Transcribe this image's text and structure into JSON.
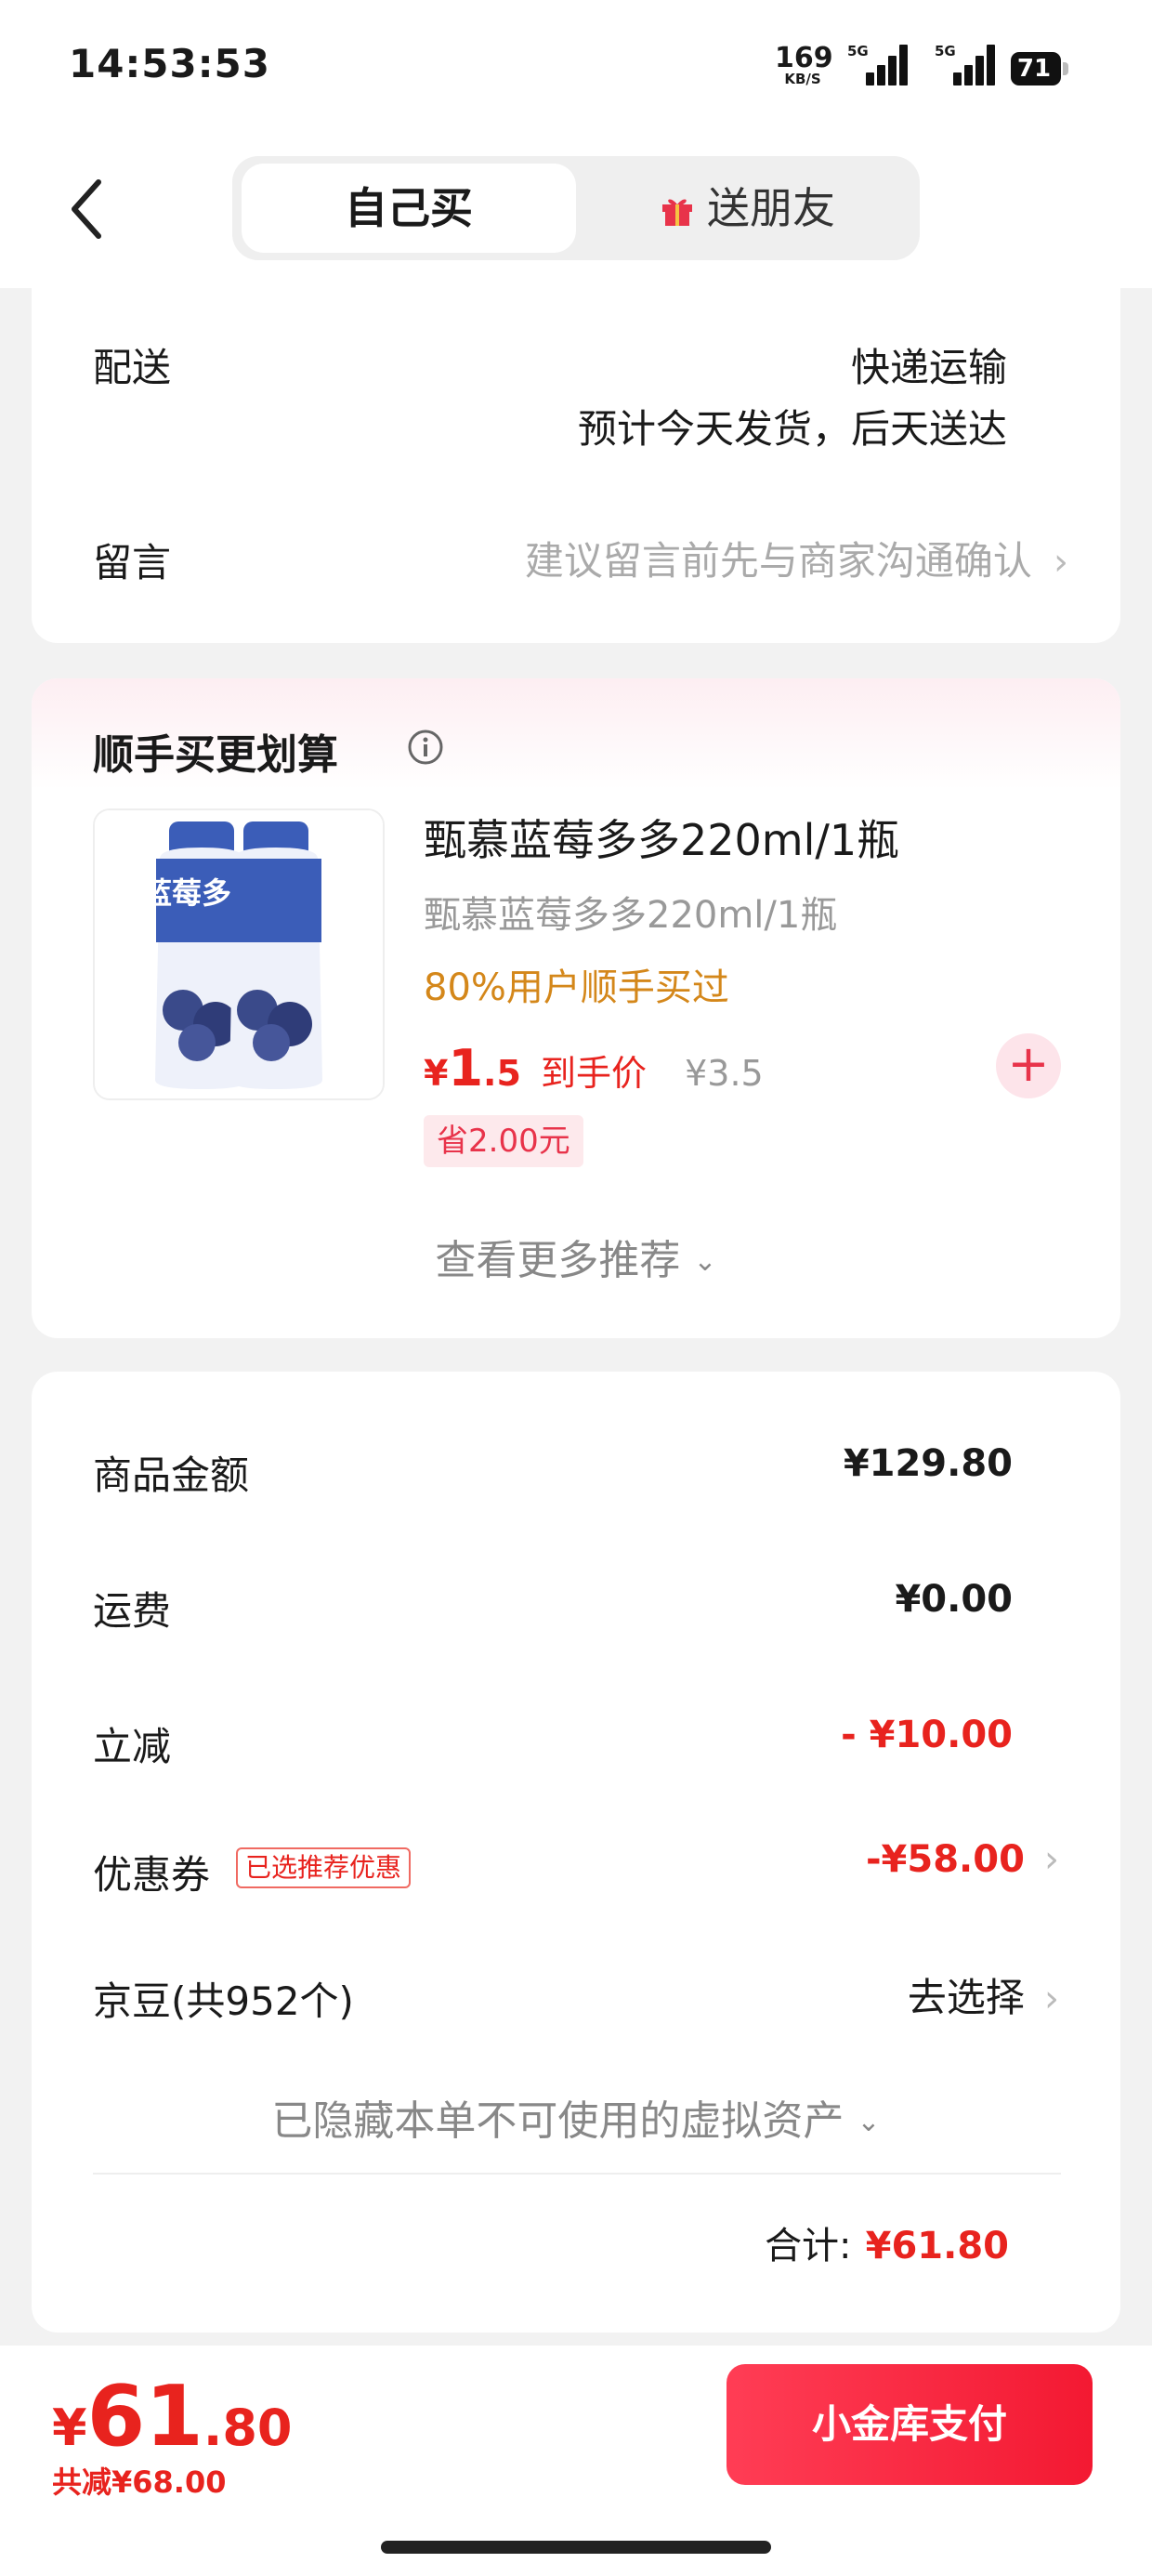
{
  "status_bar": {
    "time": "14:53:53",
    "net_speed_value": "169",
    "net_speed_unit": "KB/S",
    "sim1_label": "5G",
    "sim2_label": "5G",
    "battery": "71"
  },
  "nav": {
    "tab_self": "自己买",
    "tab_gift": "送朋友"
  },
  "delivery": {
    "label": "配送",
    "method": "快递运输",
    "estimate": "预计今天发货，后天送达",
    "message_label": "留言",
    "message_placeholder": "建议留言前先与商家沟通确认"
  },
  "upsell": {
    "title": "顺手买更划算",
    "product": {
      "name": "甄慕蓝莓多多220ml/1瓶",
      "spec": "甄慕蓝莓多多220ml/1瓶",
      "social_proof": "80%用户顺手买过",
      "currency": "¥",
      "price_int": "1",
      "price_dec": ".5",
      "price_label": "到手价",
      "orig_price": "¥3.5",
      "save": "省2.00元",
      "bottle_text": "蓝莓多多"
    },
    "more": "查看更多推荐"
  },
  "summary": {
    "goods_label": "商品金额",
    "goods_value": "¥129.80",
    "shipping_label": "运费",
    "shipping_value": "¥0.00",
    "discount_label": "立减",
    "discount_value": "- ¥10.00",
    "coupon_label": "优惠券",
    "coupon_tag": "已选推荐优惠",
    "coupon_value": "-¥58.00",
    "jd_bean_label": "京豆(共952个)",
    "jd_bean_value": "去选择",
    "hidden_assets": "已隐藏本单不可使用的虚拟资产",
    "total_label": "合计:",
    "total_value": "¥61.80"
  },
  "bottom": {
    "currency": "¥",
    "price_int": "61",
    "price_dec": ".80",
    "total_saved": "共减¥68.00",
    "pay_button": "小金库支付"
  },
  "colors": {
    "accent_red": "#e8231e",
    "pay_button": "#f31932",
    "social_proof": "#d4871a"
  }
}
